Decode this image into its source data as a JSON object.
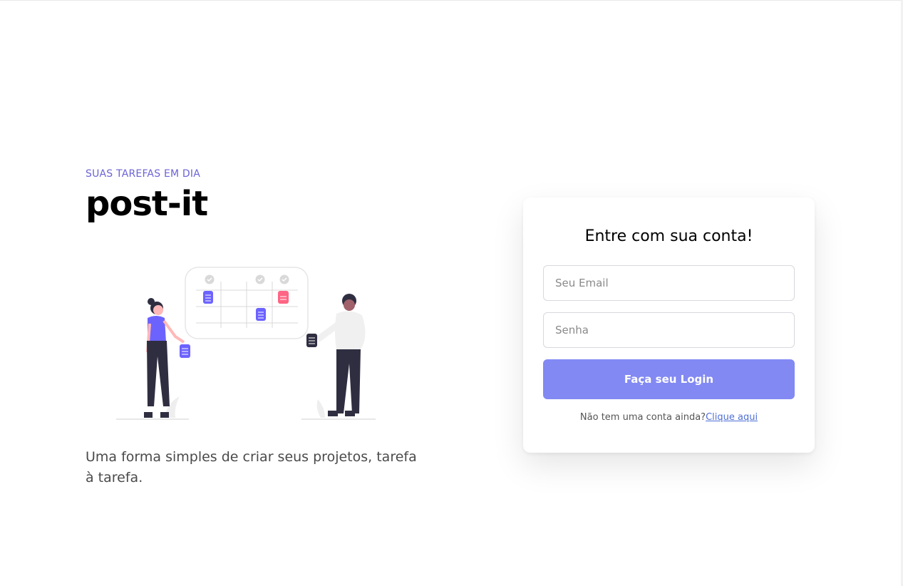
{
  "hero": {
    "eyebrow": "SUAS TAREFAS EM DIA",
    "brand": "post-it",
    "tagline": "Uma forma simples de criar seus projetos, tarefa à tarefa."
  },
  "login": {
    "title": "Entre com sua conta!",
    "email_placeholder": "Seu Email",
    "email_value": "",
    "password_placeholder": "Senha",
    "password_value": "",
    "submit_label": "Faça seu Login",
    "signup_prompt": "Não tem uma conta ainda?",
    "signup_link": "Clique aqui"
  },
  "colors": {
    "accent": "#6c63d6",
    "button": "#8289f3",
    "link": "#4f6fd6",
    "sticky_purple": "#6c63ff",
    "sticky_pink": "#ff6584"
  },
  "illustration": {
    "icon": "team-planning-illustration"
  }
}
